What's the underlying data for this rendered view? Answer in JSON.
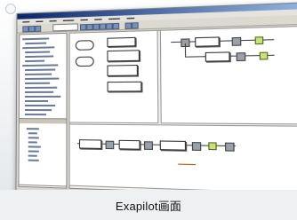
{
  "caption": "Exapilot画面",
  "window": {
    "menu_items": [
      "",
      "",
      "",
      "",
      "",
      "",
      "",
      ""
    ],
    "toolbar_buttons": 12,
    "tree_rows": 18,
    "bottom_tree_rows": 8
  },
  "colors": {
    "title_gradient_start": "#0a246a",
    "title_gradient_end": "#a6caf0",
    "node_green": "#cbe27a",
    "node_grey": "#9aa0a8",
    "annotation_orange": "#b05a14"
  }
}
